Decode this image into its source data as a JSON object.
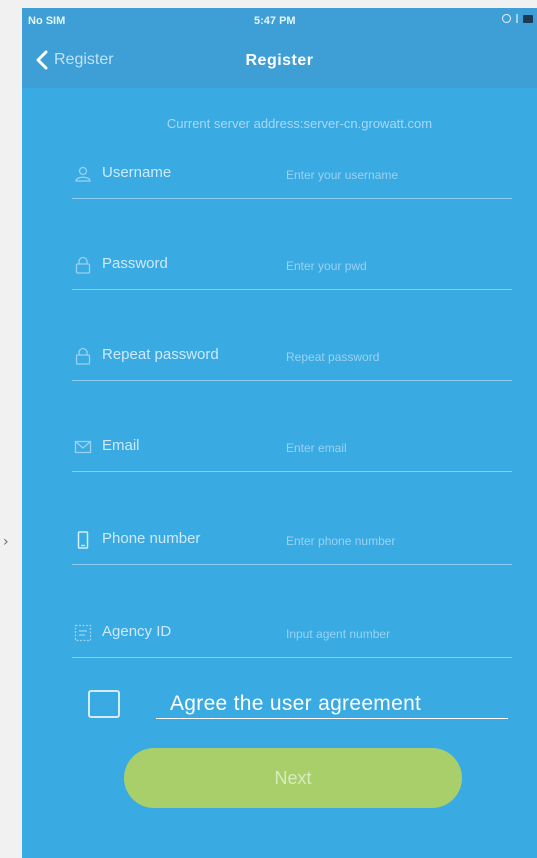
{
  "status_bar": {
    "carrier": "No SIM",
    "time": "5:47 PM"
  },
  "nav": {
    "back_label": "Register",
    "title": "Register"
  },
  "server_info": "Current server address:server-cn.growatt.com",
  "form": {
    "rows": [
      {
        "icon": "user-icon",
        "label": "Username",
        "placeholder": "Enter your username"
      },
      {
        "icon": "lock-icon",
        "label": "Password",
        "placeholder": "Enter your pwd"
      },
      {
        "icon": "lock-icon",
        "label": "Repeat password",
        "placeholder": "Repeat password"
      },
      {
        "icon": "mail-icon",
        "label": "Email",
        "placeholder": "Enter email"
      },
      {
        "icon": "phone-icon",
        "label": "Phone number",
        "placeholder": "Enter phone number"
      },
      {
        "icon": "agency-icon",
        "label": "Agency ID",
        "placeholder": "Input agent number"
      }
    ]
  },
  "agreement": {
    "checked": false,
    "label": "Agree the user agreement"
  },
  "next_button": "Next",
  "colors": {
    "background": "#3aaae2",
    "nav_bar": "#3d9fd6",
    "next_button": "#a9cf6b"
  }
}
